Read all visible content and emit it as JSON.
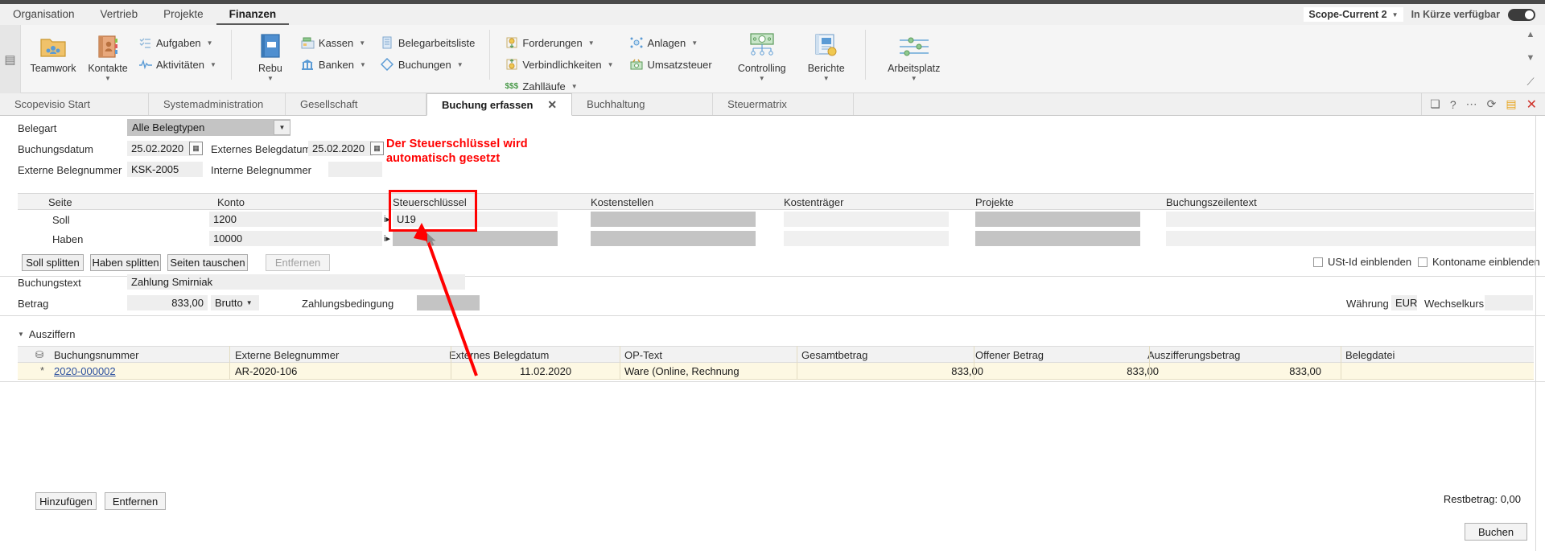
{
  "menubar": {
    "items": [
      {
        "label": "Organisation",
        "active": false
      },
      {
        "label": "Vertrieb",
        "active": false
      },
      {
        "label": "Projekte",
        "active": false
      },
      {
        "label": "Finanzen",
        "active": true
      }
    ],
    "scope_value": "Scope-Current 2",
    "availability_label": "In Kürze verfügbar",
    "toggle_state": "on"
  },
  "ribbon": {
    "groups": [
      {
        "big": [
          {
            "label": "Teamwork",
            "icon": "teamwork-folder-icon",
            "caret": false
          },
          {
            "label": "Kontakte",
            "icon": "contacts-book-icon",
            "caret": true
          }
        ],
        "small": [
          {
            "label": "Aufgaben",
            "icon": "tasks-list-icon",
            "caret": true
          },
          {
            "label": "Aktivitäten",
            "icon": "activities-pulse-icon",
            "caret": true
          }
        ]
      },
      {
        "big": [
          {
            "label": "Rebu",
            "icon": "rebu-book-icon",
            "caret": true
          }
        ],
        "small": [
          {
            "label": "Kassen",
            "icon": "cash-register-icon",
            "caret": true
          },
          {
            "label": "Banken",
            "icon": "bank-icon",
            "caret": true
          }
        ],
        "small2": [
          {
            "label": "Belegarbeitsliste",
            "icon": "document-list-icon",
            "caret": false
          },
          {
            "label": "Buchungen",
            "icon": "postings-icon",
            "caret": true
          }
        ]
      },
      {
        "small": [
          {
            "label": "Forderungen",
            "icon": "receivables-icon",
            "caret": true
          },
          {
            "label": "Verbindlichkeiten",
            "icon": "payables-icon",
            "caret": true
          },
          {
            "label": "Zahlläufe",
            "icon": "payment-runs-icon",
            "caret": true
          }
        ],
        "small2": [
          {
            "label": "Anlagen",
            "icon": "assets-icon",
            "caret": true
          },
          {
            "label": "Umsatzsteuer",
            "icon": "vat-icon",
            "caret": false
          }
        ],
        "big": [
          {
            "label": "Controlling",
            "icon": "controlling-icon",
            "caret": true
          },
          {
            "label": "Berichte",
            "icon": "reports-icon",
            "caret": true
          }
        ]
      },
      {
        "big": [
          {
            "label": "Arbeitsplatz",
            "icon": "workplace-sliders-icon",
            "caret": true
          }
        ]
      }
    ]
  },
  "tabs": {
    "items": [
      {
        "label": "Scopevisio Start",
        "active": false,
        "closable": false
      },
      {
        "label": "Systemadministration",
        "active": false,
        "closable": false
      },
      {
        "label": "Gesellschaft",
        "active": false,
        "closable": false
      },
      {
        "label": "Buchung erfassen",
        "active": true,
        "closable": true
      },
      {
        "label": "Buchhaltung",
        "active": false,
        "closable": false
      },
      {
        "label": "Steuermatrix",
        "active": false,
        "closable": false
      }
    ],
    "right_icons": [
      "copy-icon",
      "help-icon",
      "more-icon",
      "refresh-icon",
      "save-icon",
      "close-icon"
    ]
  },
  "form": {
    "belegart_label": "Belegart",
    "belegart_value": "Alle Belegtypen",
    "buchungsdatum_label": "Buchungsdatum",
    "buchungsdatum_value": "25.02.2020",
    "externes_belegdatum_label": "Externes Belegdatum",
    "externes_belegdatum_value": "25.02.2020",
    "externe_belegnummer_label": "Externe Belegnummer",
    "externe_belegnummer_value": "KSK-2005",
    "interne_belegnummer_label": "Interne Belegnummer",
    "interne_belegnummer_value": "",
    "buchungstext_label": "Buchungstext",
    "buchungstext_value": "Zahlung Smirniak",
    "betrag_label": "Betrag",
    "betrag_value": "833,00",
    "betrag_mode": "Brutto",
    "zahlungsbedingung_label": "Zahlungsbedingung",
    "zahlungsbedingung_value": "",
    "waehrung_label": "Währung",
    "waehrung_value": "EUR",
    "wechselkurs_label": "Wechselkurs",
    "wechselkurs_value": ""
  },
  "annotation": {
    "line1": "Der Steuerschlüssel wird",
    "line2": "automatisch gesetzt",
    "color": "#ff0000"
  },
  "booking_grid": {
    "columns": [
      "Seite",
      "Konto",
      "Steuerschlüssel",
      "Kostenstellen",
      "Kostenträger",
      "Projekte",
      "Buchungszeilentext"
    ],
    "rows": [
      {
        "seite": "Soll",
        "konto": "1200",
        "steuerschluessel": "U19",
        "kostenstellen": "",
        "kostentraeger": "",
        "projekte": "",
        "buchungszeilentext": ""
      },
      {
        "seite": "Haben",
        "konto": "10000",
        "steuerschluessel": "",
        "kostenstellen": "",
        "kostentraeger": "",
        "projekte": "",
        "buchungszeilentext": ""
      }
    ]
  },
  "split_buttons": [
    {
      "label": "Soll splitten",
      "disabled": false
    },
    {
      "label": "Haben splitten",
      "disabled": false
    },
    {
      "label": "Seiten tauschen",
      "disabled": false
    },
    {
      "label": "Entfernen",
      "disabled": true
    }
  ],
  "checkboxes": [
    {
      "label": "USt-Id einblenden",
      "checked": false
    },
    {
      "label": "Kontoname einblenden",
      "checked": false
    }
  ],
  "ausziffern": {
    "section_label": "Ausziffern",
    "columns": [
      "Buchungsnummer",
      "Externe Belegnummer",
      "Externes Belegdatum",
      "OP-Text",
      "Gesamtbetrag",
      "Offener Betrag",
      "Auszifferungsbetrag",
      "Belegdatei"
    ],
    "rows": [
      {
        "marker": "*",
        "buchungsnummer": "2020-000002",
        "externe_belegnummer": "AR-2020-106",
        "externes_belegdatum": "11.02.2020",
        "op_text": "Ware (Online, Rechnung",
        "gesamtbetrag": "833,00",
        "offener_betrag": "833,00",
        "auszifferungsbetrag": "833,00",
        "belegdatei": ""
      }
    ]
  },
  "footer": {
    "add_label": "Hinzufügen",
    "remove_label": "Entfernen",
    "restbetrag_label": "Restbetrag: 0,00",
    "buchen_label": "Buchen"
  }
}
